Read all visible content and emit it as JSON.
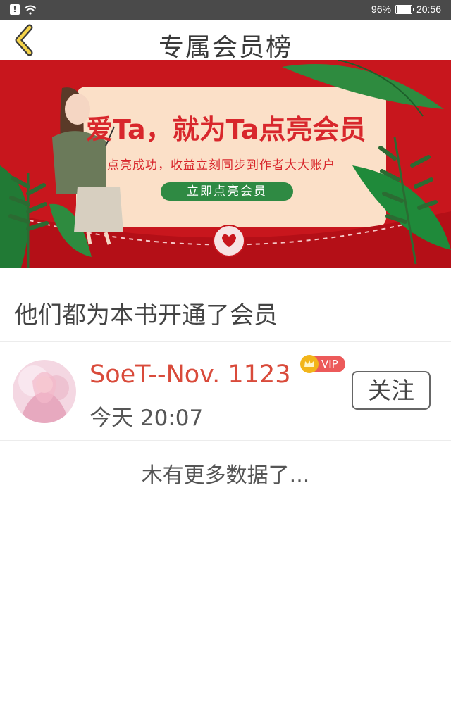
{
  "status_bar": {
    "battery": "96%",
    "time": "20:56",
    "battery_level": 0.96,
    "icons": [
      "alert-icon",
      "wifi-icon",
      "battery-icon"
    ]
  },
  "header": {
    "title": "专属会员榜",
    "back_icon": "chevron-left-icon"
  },
  "banner": {
    "headline": "爱Ta，就为Ta点亮会员",
    "subline": "点亮成功，收益立刻同步到作者大大账户",
    "cta": "立即点亮会员",
    "colors": {
      "background": "#c8161d",
      "card": "#fbe0c8",
      "cta": "#2f8a43",
      "headline": "#d8272c"
    }
  },
  "section": {
    "title": "他们都为本书开通了会员"
  },
  "members": [
    {
      "name": "SoeT--Nov. 1123",
      "badge": "VIP",
      "time": "今天 20:07",
      "follow_label": "关注"
    }
  ],
  "footer": {
    "no_more": "木有更多数据了..."
  },
  "colors": {
    "accent": "#d94b3b",
    "vip_badge": "#ec5a5a",
    "crown": "#f2b51a"
  }
}
